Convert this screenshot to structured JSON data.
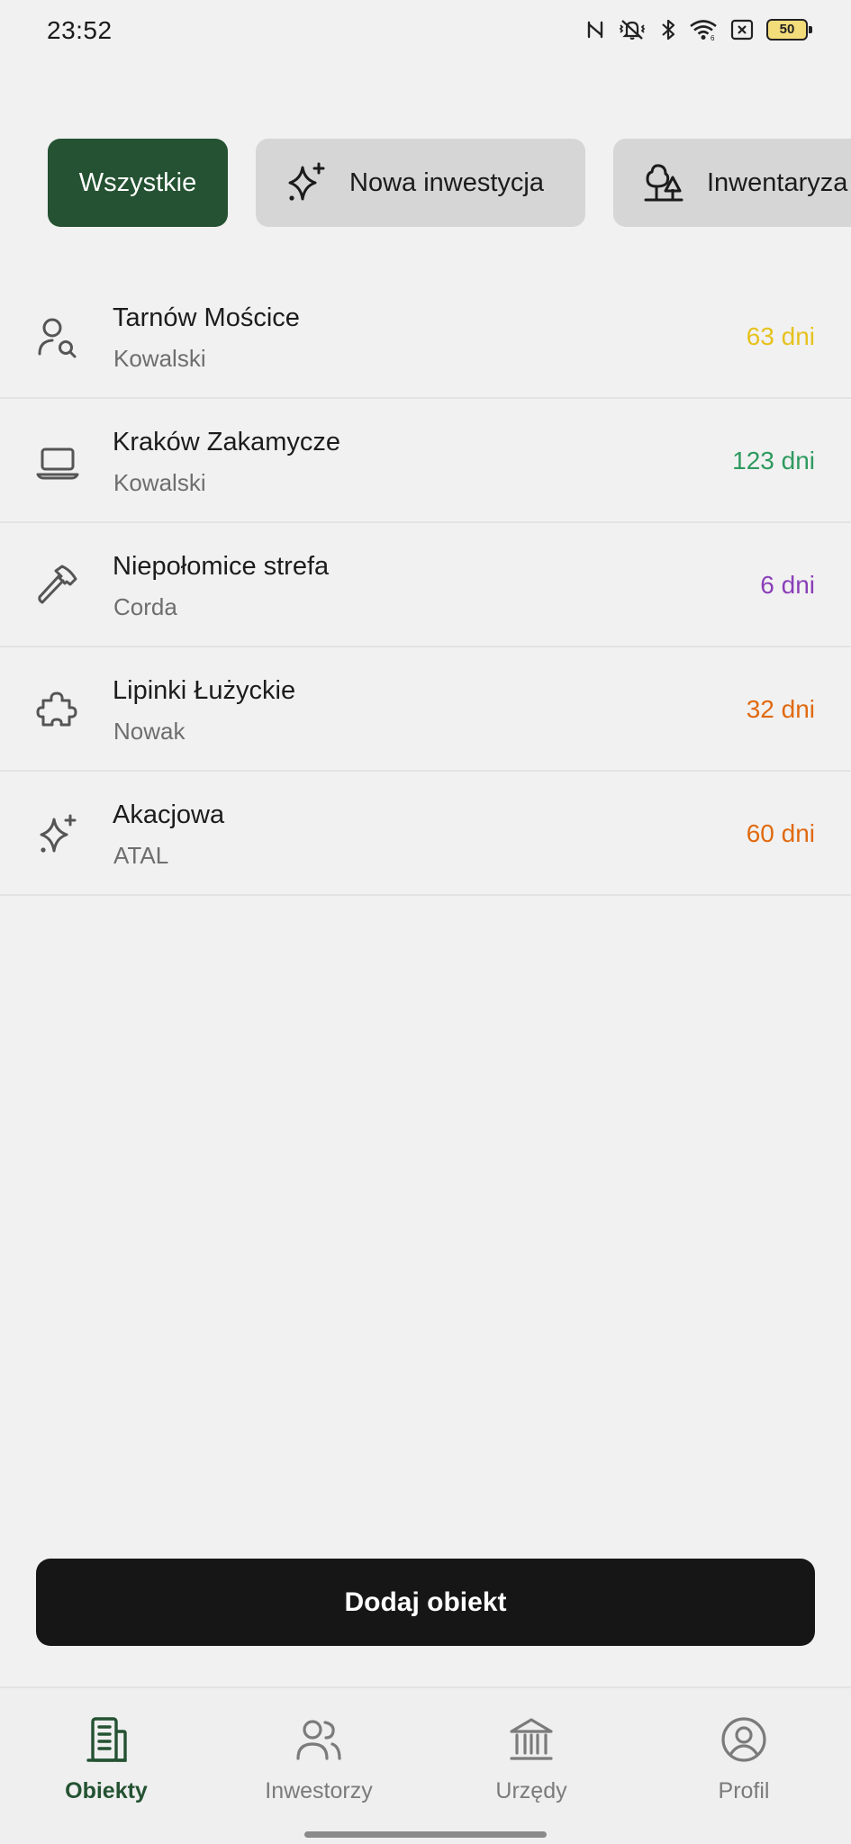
{
  "status_bar": {
    "time": "23:52",
    "battery": "50",
    "icons": [
      "nfc-icon",
      "vibrate-icon",
      "bluetooth-icon",
      "wifi-icon",
      "sim-off-icon",
      "battery-icon"
    ]
  },
  "filters": [
    {
      "label": "Wszystkie",
      "active": true,
      "icon": null
    },
    {
      "label": "Nowa inwestycja",
      "active": false,
      "icon": "sparkles-icon"
    },
    {
      "label": "Inwentaryza",
      "active": false,
      "icon": "trees-icon"
    }
  ],
  "objects": [
    {
      "title": "Tarnów Mościce",
      "subtitle": "Kowalski",
      "days": "63 dni",
      "color": "#e6c21e",
      "icon": "user-search-icon"
    },
    {
      "title": "Kraków Zakamycze",
      "subtitle": "Kowalski",
      "days": "123 dni",
      "color": "#2e9a5f",
      "icon": "laptop-icon"
    },
    {
      "title": "Niepołomice strefa",
      "subtitle": "Corda",
      "days": "6 dni",
      "color": "#8a3fb8",
      "icon": "axe-icon"
    },
    {
      "title": "Lipinki Łużyckie",
      "subtitle": "Nowak",
      "days": "32 dni",
      "color": "#e06a10",
      "icon": "puzzle-icon"
    },
    {
      "title": "Akacjowa",
      "subtitle": "ATAL",
      "days": "60 dni",
      "color": "#e06a10",
      "icon": "sparkles-icon"
    }
  ],
  "add_button": "Dodaj obiekt",
  "nav": [
    {
      "label": "Obiekty",
      "active": true,
      "icon": "building-icon"
    },
    {
      "label": "Inwestorzy",
      "active": false,
      "icon": "users-icon"
    },
    {
      "label": "Urzędy",
      "active": false,
      "icon": "bank-icon"
    },
    {
      "label": "Profil",
      "active": false,
      "icon": "user-circle-icon"
    }
  ],
  "colors": {
    "accent": "#245232",
    "background": "#f1f1f1",
    "chip_inactive": "#d6d6d6",
    "button": "#161616"
  }
}
